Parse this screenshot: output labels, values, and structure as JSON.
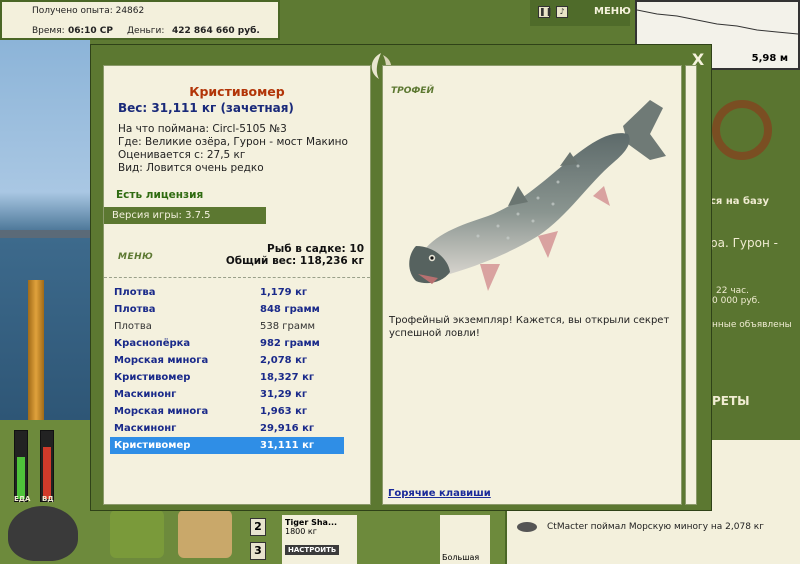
{
  "hud": {
    "experience": "Получено опыта: 24862",
    "time_label": "Время:",
    "time_value": "06:10 СР",
    "money_label": "Деньги:",
    "money_value": "422 864 660 руб.",
    "menu_label": "МЕНЮ",
    "depth": "5,98 м"
  },
  "sidebar": {
    "base_button": "ся на базу",
    "location_1": "ра. Гурон -",
    "time_left": "22 час.",
    "price": "0 000 руб.",
    "notice": "нные объявлены",
    "secrets": "РЕТЫ",
    "chat_message": "CtMacter поймал Морскую миногу на 2,078 кг"
  },
  "inventory": {
    "slot_2": "2",
    "slot_3": "3",
    "lure_name": "Tiger Sha...",
    "lure_weight": "1800 кг",
    "setup_button": "НАСТРОИТЬ",
    "lure_caption": "Большая",
    "food_label": "ЕДА",
    "energy_label": "ВД"
  },
  "modal": {
    "close": "X",
    "fish_name": "Кристивомер",
    "weight": "Вес: 31,111 кг (зачетная)",
    "details": [
      "На что поймана: Circl-5105 №3",
      "Где: Великие озёра, Гурон - мост Макино",
      "Оценивается с: 27,5 кг",
      "Вид: Ловится очень редко"
    ],
    "license": "Есть лицензия",
    "version": "Версия игры: 3.7.5",
    "menu": "МЕНЮ",
    "keep_count": "Рыб в садке: 10",
    "keep_weight": "Общий вес: 118,236 кг",
    "catches": [
      {
        "name": "Плотва",
        "weight": "1,179 кг",
        "style": "bold"
      },
      {
        "name": "Плотва",
        "weight": "848 грамм",
        "style": "bold"
      },
      {
        "name": "Плотва",
        "weight": "538 грамм",
        "style": "plain"
      },
      {
        "name": "Краснопёрка",
        "weight": "982 грамм",
        "style": "bold"
      },
      {
        "name": "Морская минога",
        "weight": "2,078 кг",
        "style": "bold"
      },
      {
        "name": "Кристивомер",
        "weight": "18,327 кг",
        "style": "bold"
      },
      {
        "name": "Маскинонг",
        "weight": "31,29 кг",
        "style": "bold"
      },
      {
        "name": "Морская минога",
        "weight": "1,963 кг",
        "style": "bold"
      },
      {
        "name": "Маскинонг",
        "weight": "29,916 кг",
        "style": "bold"
      },
      {
        "name": "Кристивомер",
        "weight": "31,111 кг",
        "style": "selected"
      }
    ],
    "trophy_label": "ТРОФЕЙ",
    "trophy_text": "Трофейный экземпляр! Кажется, вы открыли секрет успешной ловли!",
    "hotkeys": "Горячие клавиши"
  },
  "colors": {
    "frame_green": "#5c7831",
    "panel_cream": "#f4f1de",
    "title_red": "#b23508",
    "link_blue": "#1a2a8a",
    "selected_blue": "#2f8ee6"
  }
}
